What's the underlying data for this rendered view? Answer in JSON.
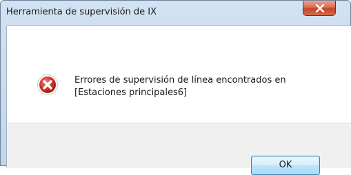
{
  "window": {
    "title": "Herramienta de supervisión de IX"
  },
  "dialog": {
    "icon": "error-icon",
    "message_line1": "Errores de supervisión de línea encontrados en",
    "message_line2": "[Estaciones principales6]",
    "ok_label": "OK"
  },
  "colors": {
    "error_red": "#d53b2c",
    "button_border": "#3c7fb1"
  }
}
